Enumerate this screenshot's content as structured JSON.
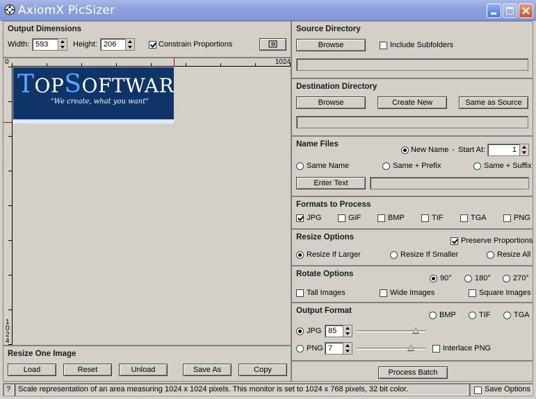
{
  "window": {
    "title": "AxiomX PicSizer"
  },
  "output_dimensions": {
    "title": "Output Dimensions",
    "width_label": "Width:",
    "width_value": "593",
    "height_label": "Height:",
    "height_value": "206",
    "constrain_label": "Constrain Proportions",
    "constrain_checked": true
  },
  "preview": {
    "ruler_start": "0",
    "ruler_end": "1024",
    "ruler_left_digits": [
      "1",
      "0",
      "2",
      "4"
    ],
    "logo_prefix_big": "T",
    "logo_part1": "OP",
    "logo_prefix_big2": "S",
    "logo_part2": "OFTWARE",
    "logo_tagline": "\"We create, what you want\""
  },
  "resize_one": {
    "title": "Resize One Image",
    "buttons": [
      "Load",
      "Reset",
      "Unload",
      "Save As",
      "Copy"
    ]
  },
  "source": {
    "title": "Source Directory",
    "browse_label": "Browse",
    "include_sub_label": "Include Subfolders",
    "path": ""
  },
  "destination": {
    "title": "Destination Directory",
    "browse_label": "Browse",
    "create_new_label": "Create New",
    "same_as_source_label": "Same as Source",
    "path": ""
  },
  "name_files": {
    "title": "Name Files",
    "new_name_label": "New Name",
    "dash": "-",
    "start_at_label": "Start At:",
    "start_at_value": "1",
    "same_name_label": "Same Name",
    "same_prefix_label": "Same + Prefix",
    "same_suffix_label": "Same + Suffix",
    "enter_text_label": "Enter Text",
    "text_value": ""
  },
  "formats": {
    "title": "Formats to Process",
    "items": [
      {
        "label": "JPG",
        "checked": true
      },
      {
        "label": "GIF",
        "checked": false
      },
      {
        "label": "BMP",
        "checked": false
      },
      {
        "label": "TIF",
        "checked": false
      },
      {
        "label": "TGA",
        "checked": false
      },
      {
        "label": "PNG",
        "checked": false
      }
    ]
  },
  "resize_options": {
    "title": "Resize Options",
    "preserve_label": "Preserve Proportions",
    "preserve_checked": true,
    "larger_label": "Resize If Larger",
    "smaller_label": "Resize If Smaller",
    "all_label": "Resize All"
  },
  "rotate_options": {
    "title": "Rotate Options",
    "deg90": "90°",
    "deg180": "180°",
    "deg270": "270°",
    "tall_label": "Tall Images",
    "wide_label": "Wide Images",
    "square_label": "Square Images"
  },
  "output_format": {
    "title": "Output Format",
    "bmp_label": "BMP",
    "tif_label": "TIF",
    "tga_label": "TGA",
    "jpg_label": "JPG",
    "jpg_quality": "85",
    "jpg_quality_level": 85,
    "png_label": "PNG",
    "png_compression": "7",
    "png_compression_level": 7,
    "interlace_label": "Interlace PNG"
  },
  "process_batch_label": "Process Batch",
  "status": {
    "help_label": "?",
    "message": "Scale representation of an area measuring 1024 x 1024 pixels. This monitor is set to 1024 x 768 pixels, 32 bit color.",
    "save_options_label": "Save Options"
  },
  "colors": {
    "titlebar": "#8ea2dc",
    "logo_bg": "#0e3468",
    "logo_accent": "#59a7ff"
  }
}
